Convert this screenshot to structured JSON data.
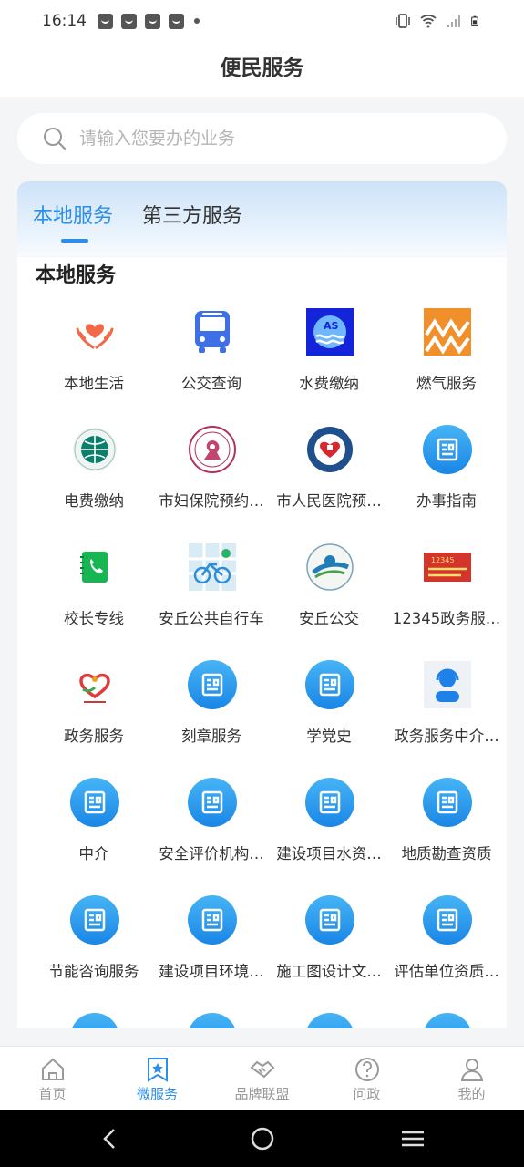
{
  "status": {
    "time": "16:14"
  },
  "header": {
    "title": "便民服务"
  },
  "search": {
    "placeholder": "请输入您要办的业务"
  },
  "tabs": [
    {
      "label": "本地服务",
      "active": true
    },
    {
      "label": "第三方服务",
      "active": false
    }
  ],
  "section": {
    "title": "本地服务"
  },
  "services": [
    {
      "label": "本地生活",
      "icon": "heart-hands-icon"
    },
    {
      "label": "公交查询",
      "icon": "bus-icon"
    },
    {
      "label": "水费缴纳",
      "icon": "water-logo-icon"
    },
    {
      "label": "燃气服务",
      "icon": "gas-logo-icon"
    },
    {
      "label": "电费缴纳",
      "icon": "state-grid-logo-icon"
    },
    {
      "label": "市妇保院预约…",
      "icon": "maternity-hospital-logo-icon"
    },
    {
      "label": "市人民医院预…",
      "icon": "peoples-hospital-logo-icon"
    },
    {
      "label": "办事指南",
      "icon": "document-icon"
    },
    {
      "label": "校长专线",
      "icon": "phone-book-icon"
    },
    {
      "label": "安丘公共自行车",
      "icon": "bicycle-map-icon"
    },
    {
      "label": "安丘公交",
      "icon": "anqiu-bus-logo-icon"
    },
    {
      "label": "12345政务服…",
      "icon": "hotline-12345-icon"
    },
    {
      "label": "政务服务",
      "icon": "heart-service-logo-icon"
    },
    {
      "label": "刻章服务",
      "icon": "document-icon"
    },
    {
      "label": "学党史",
      "icon": "document-icon"
    },
    {
      "label": "政务服务中介…",
      "icon": "customer-service-icon"
    },
    {
      "label": "中介",
      "icon": "document-icon"
    },
    {
      "label": "安全评价机构…",
      "icon": "document-icon"
    },
    {
      "label": "建设项目水资…",
      "icon": "document-icon"
    },
    {
      "label": "地质勘查资质",
      "icon": "document-icon"
    },
    {
      "label": "节能咨询服务",
      "icon": "document-icon"
    },
    {
      "label": "建设项目环境…",
      "icon": "document-icon"
    },
    {
      "label": "施工图设计文…",
      "icon": "document-icon"
    },
    {
      "label": "评估单位资质…",
      "icon": "document-icon"
    }
  ],
  "hotline_badge": {
    "number": "12345"
  },
  "bottom_nav": [
    {
      "label": "首页",
      "icon": "home-icon",
      "active": false
    },
    {
      "label": "微服务",
      "icon": "star-bookmark-icon",
      "active": true
    },
    {
      "label": "品牌联盟",
      "icon": "handshake-icon",
      "active": false
    },
    {
      "label": "问政",
      "icon": "question-icon",
      "active": false
    },
    {
      "label": "我的",
      "icon": "user-icon",
      "active": false
    }
  ],
  "colors": {
    "accent": "#2b8ee8",
    "doc_icon": "#1a86e6",
    "background": "#f4f5f7"
  }
}
